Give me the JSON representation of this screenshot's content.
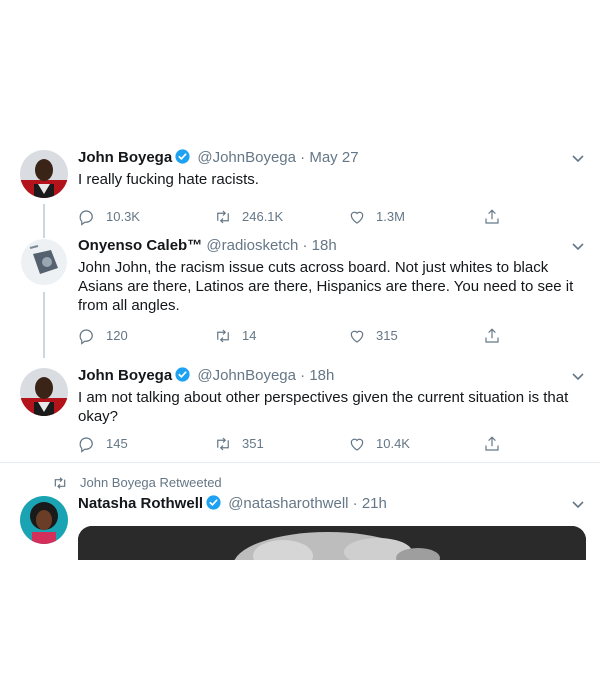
{
  "tweets": [
    {
      "name": "John Boyega",
      "handle": "@JohnBoyega",
      "dot": "·",
      "time": "May 27",
      "text": "I really fucking hate racists.",
      "replies": "10.3K",
      "retweets": "246.1K",
      "likes": "1.3M",
      "verified": true
    },
    {
      "name": "Onyenso Caleb™",
      "handle": "@radiosketch",
      "dot": "·",
      "time": "18h",
      "text": "John John, the racism issue cuts across board. Not just whites to black Asians are there, Latinos are there, Hispanics are there. You need to see it from all angles.",
      "replies": "120",
      "retweets": "14",
      "likes": "315",
      "verified": false
    },
    {
      "name": "John Boyega",
      "handle": "@JohnBoyega",
      "dot": "·",
      "time": "18h",
      "text": "I am not talking about other perspectives given the current situation is that okay?",
      "replies": "145",
      "retweets": "351",
      "likes": "10.4K",
      "verified": true
    },
    {
      "retweeted_by": "John Boyega Retweeted",
      "name": "Natasha Rothwell",
      "handle": "@natasharothwell",
      "dot": "·",
      "time": "21h",
      "verified": true
    }
  ],
  "colors": {
    "text": "#14171a",
    "secondary": "#657786",
    "verified": "#1da1f2",
    "divider": "#e6ecf0",
    "thread_line": "#ccd6dd"
  },
  "icons": [
    "reply-icon",
    "retweet-icon",
    "like-icon",
    "share-icon",
    "chevron-down-icon",
    "verified-badge-icon"
  ]
}
